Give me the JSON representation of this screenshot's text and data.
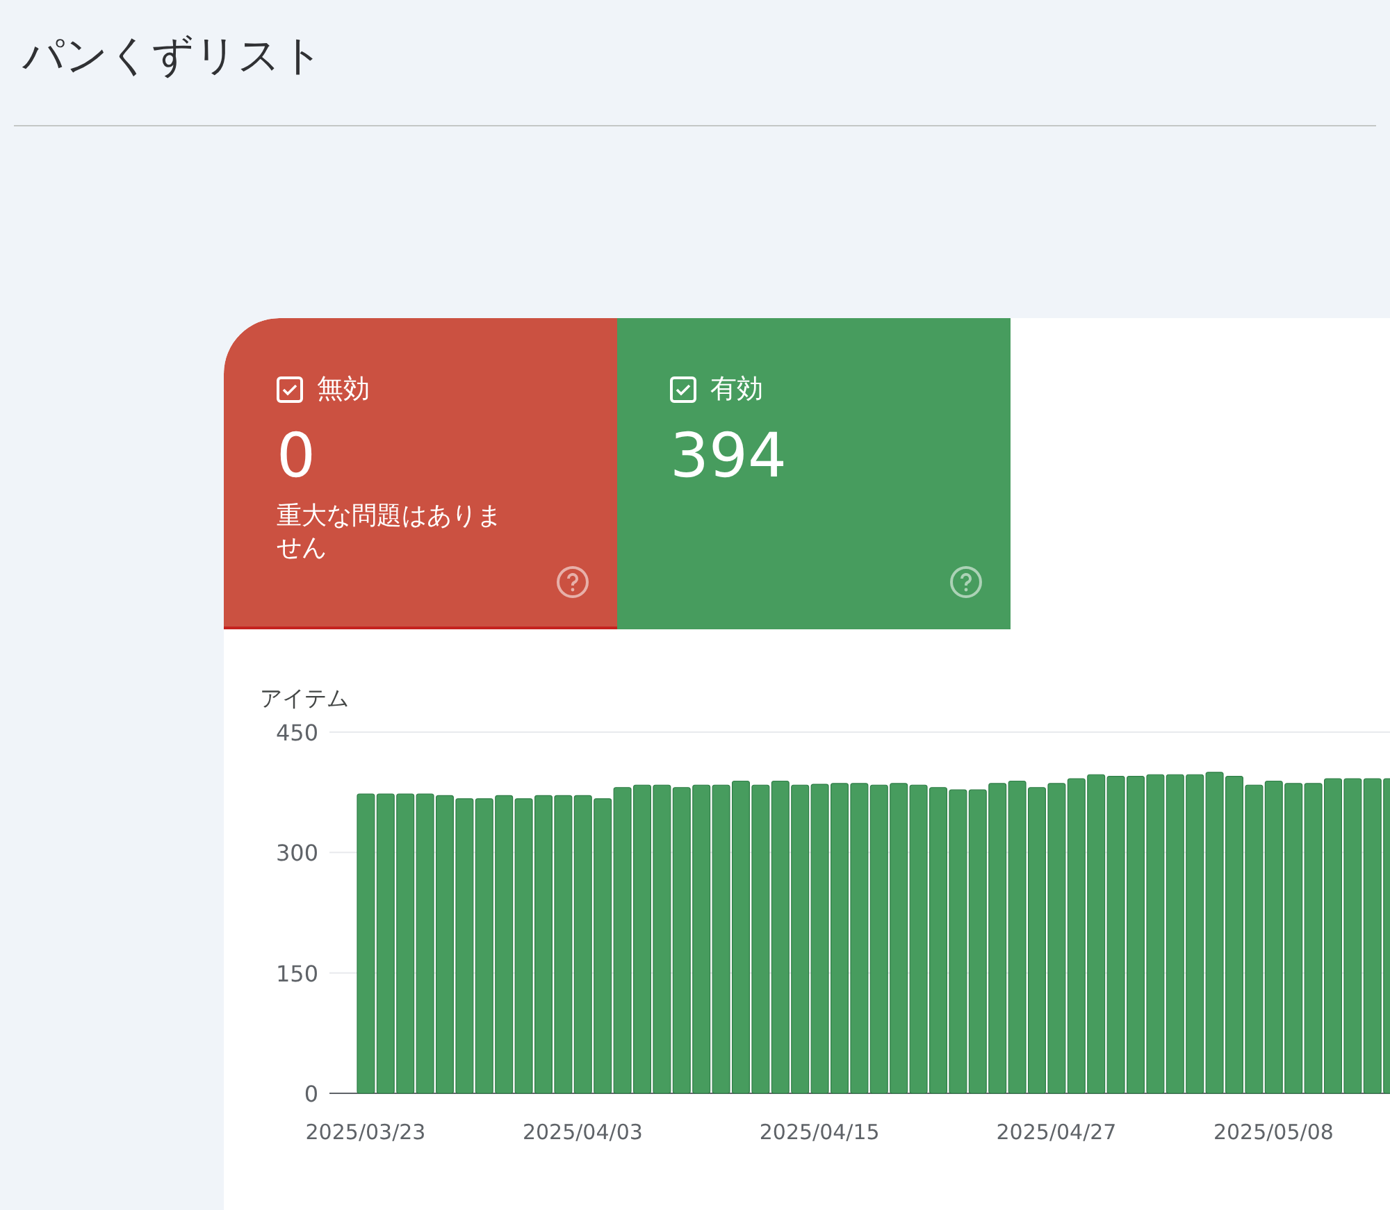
{
  "page": {
    "title": "パンくずリスト"
  },
  "tiles": [
    {
      "label": "無効",
      "checked": true,
      "count": "0",
      "note": "重大な問題はありません",
      "color": "#cb5141"
    },
    {
      "label": "有効",
      "checked": true,
      "count": "394",
      "color": "#479c5e"
    }
  ],
  "chart": {
    "chart_data": {
      "type": "bar",
      "title": "アイテム",
      "ylim": [
        0,
        450
      ],
      "yticks": [
        0,
        150,
        300,
        450
      ],
      "categories": [
        "2025/03/23",
        null,
        null,
        null,
        null,
        null,
        null,
        null,
        null,
        null,
        null,
        "2025/04/03",
        null,
        null,
        null,
        null,
        null,
        null,
        null,
        null,
        null,
        null,
        null,
        "2025/04/15",
        null,
        null,
        null,
        null,
        null,
        null,
        null,
        null,
        null,
        null,
        null,
        "2025/04/27",
        null,
        null,
        null,
        null,
        null,
        null,
        null,
        null,
        null,
        null,
        "2025/05/08",
        null,
        null,
        null,
        null,
        null,
        null
      ],
      "series": [
        {
          "color": "#479c5e",
          "values": [
            373,
            373,
            373,
            373,
            371,
            367,
            367,
            371,
            367,
            371,
            371,
            371,
            367,
            381,
            384,
            384,
            381,
            384,
            384,
            389,
            384,
            389,
            384,
            385,
            386,
            386,
            384,
            386,
            384,
            381,
            378,
            378,
            386,
            389,
            381,
            386,
            392,
            397,
            395,
            395,
            397,
            397,
            397,
            400,
            395,
            384,
            389,
            386,
            386,
            392,
            392,
            392,
            392
          ]
        }
      ]
    }
  }
}
